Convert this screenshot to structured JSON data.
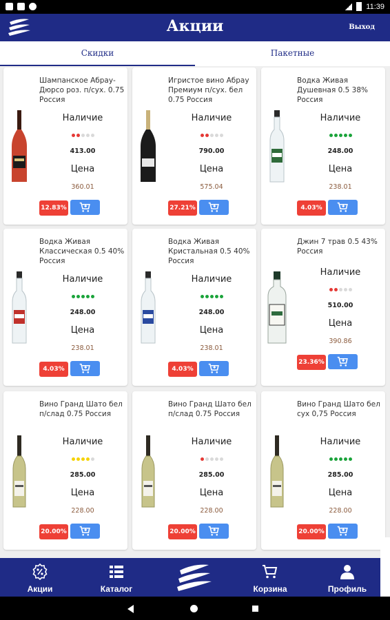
{
  "status_bar": {
    "time": "11:39"
  },
  "app_bar": {
    "title": "Акции",
    "exit_label": "Выход"
  },
  "tabs": [
    {
      "label": "Скидки",
      "active": true
    },
    {
      "label": "Пакетные",
      "active": false
    }
  ],
  "labels": {
    "availability": "Наличие",
    "price": "Цена"
  },
  "colors": {
    "primary": "#1f2b86",
    "discount_badge": "#ee4036",
    "cart_button": "#4a8ef0",
    "dot_red": "#e53935",
    "dot_green": "#1aa33a",
    "dot_yellow": "#f5d200",
    "dot_empty": "#d9d9d9",
    "price_text": "#8a5a3c"
  },
  "products": [
    {
      "name": "Шампанское Абрау-Дюрсо роз. п/сух. 0.75 Россия",
      "stock": "413.00",
      "price": "360.01",
      "discount": "12.83%",
      "availability_level": 2,
      "availability_color": "red",
      "bottle": "rose-champagne"
    },
    {
      "name": "Игристое вино Абрау Премиум п/сух. бел 0.75 Россия",
      "stock": "790.00",
      "price": "575.04",
      "discount": "27.21%",
      "availability_level": 2,
      "availability_color": "red",
      "bottle": "dark-champagne"
    },
    {
      "name": "Водка Живая Душевная 0.5 38% Россия",
      "stock": "248.00",
      "price": "238.01",
      "discount": "4.03%",
      "availability_level": 5,
      "availability_color": "green",
      "bottle": "vodka-green"
    },
    {
      "name": "Водка Живая Классическая 0.5 40% Россия",
      "stock": "248.00",
      "price": "238.01",
      "discount": "4.03%",
      "availability_level": 5,
      "availability_color": "green",
      "bottle": "vodka-red"
    },
    {
      "name": "Водка Живая Кристальная 0.5 40% Россия",
      "stock": "248.00",
      "price": "238.01",
      "discount": "4.03%",
      "availability_level": 5,
      "availability_color": "green",
      "bottle": "vodka-blue"
    },
    {
      "name": "Джин 7 трав 0.5 43% Россия",
      "stock": "510.00",
      "price": "390.86",
      "discount": "23.36%",
      "availability_level": 2,
      "availability_color": "red",
      "bottle": "gin"
    },
    {
      "name": "Вино Гранд Шато бел п/слад 0.75 Россия",
      "stock": "285.00",
      "price": "228.00",
      "discount": "20.00%",
      "availability_level": 4,
      "availability_color": "yellow",
      "bottle": "white-wine"
    },
    {
      "name": "Вино Гранд Шато бел п/слад 0.75 Россия",
      "stock": "285.00",
      "price": "228.00",
      "discount": "20.00%",
      "availability_level": 1,
      "availability_color": "red",
      "bottle": "white-wine"
    },
    {
      "name": "Вино Гранд Шато бел сух 0,75 Россия",
      "stock": "285.00",
      "price": "228.00",
      "discount": "20.00%",
      "availability_level": 5,
      "availability_color": "green",
      "bottle": "white-wine"
    }
  ],
  "bottom_nav": [
    {
      "label": "Акции",
      "icon": "discount-icon",
      "active": true
    },
    {
      "label": "Каталог",
      "icon": "catalog-icon",
      "active": false
    },
    {
      "label": "",
      "icon": "logo-icon",
      "active": false
    },
    {
      "label": "Корзина",
      "icon": "cart-icon",
      "active": false
    },
    {
      "label": "Профиль",
      "icon": "profile-icon",
      "active": false
    }
  ]
}
